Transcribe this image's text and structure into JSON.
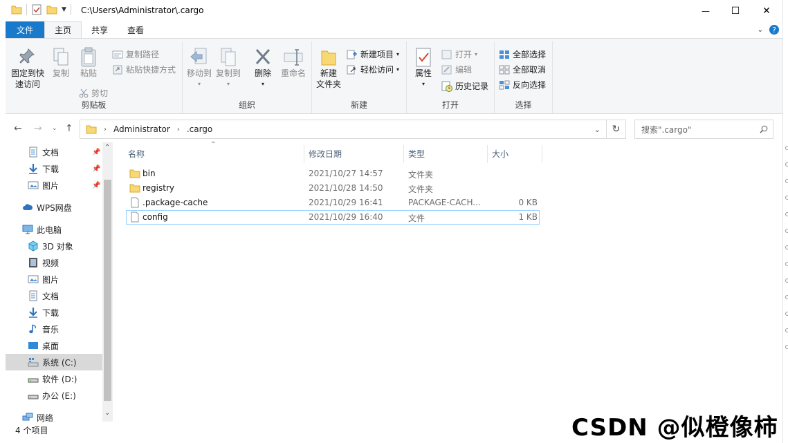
{
  "window": {
    "title": "C:\\Users\\Administrator\\.cargo",
    "minimize": "—",
    "maximize": "☐",
    "close": "✕"
  },
  "tabs": {
    "file": "文件",
    "home": "主页",
    "share": "共享",
    "view": "查看"
  },
  "ribbon": {
    "clipboard": {
      "label": "剪贴板",
      "pin": "固定到快速访问",
      "pin_line1": "固定到快",
      "pin_line2": "速访问",
      "copy": "复制",
      "paste": "粘贴",
      "copy_path": "复制路径",
      "paste_shortcut": "粘贴快捷方式",
      "cut": "剪切"
    },
    "organize": {
      "label": "组织",
      "move_to": "移动到",
      "copy_to": "复制到",
      "delete": "删除",
      "rename": "重命名"
    },
    "new": {
      "label": "新建",
      "new_folder_line1": "新建",
      "new_folder_line2": "文件夹",
      "new_item": "新建项目",
      "easy_access": "轻松访问"
    },
    "open": {
      "label": "打开",
      "properties": "属性",
      "open": "打开",
      "edit": "编辑",
      "history": "历史记录"
    },
    "select": {
      "label": "选择",
      "select_all": "全部选择",
      "select_none": "全部取消",
      "invert": "反向选择"
    }
  },
  "address": {
    "segments": [
      "Administrator",
      ".cargo"
    ],
    "search_placeholder": "搜索\".cargo\""
  },
  "nav": {
    "items": [
      {
        "label": "文档",
        "icon": "document-icon",
        "pinned": true
      },
      {
        "label": "下载",
        "icon": "download-icon",
        "pinned": true
      },
      {
        "label": "图片",
        "icon": "picture-icon",
        "pinned": true
      },
      {
        "label": "WPS网盘",
        "icon": "cloud-icon",
        "pinned": false
      },
      {
        "label": "此电脑",
        "icon": "computer-icon",
        "pinned": false
      },
      {
        "label": "3D 对象",
        "icon": "3d-objects-icon",
        "pinned": false
      },
      {
        "label": "视频",
        "icon": "video-icon",
        "pinned": false
      },
      {
        "label": "图片",
        "icon": "picture-icon",
        "pinned": false
      },
      {
        "label": "文档",
        "icon": "document-icon",
        "pinned": false
      },
      {
        "label": "下载",
        "icon": "download-icon",
        "pinned": false
      },
      {
        "label": "音乐",
        "icon": "music-icon",
        "pinned": false
      },
      {
        "label": "桌面",
        "icon": "desktop-icon",
        "pinned": false
      },
      {
        "label": "系统 (C:)",
        "icon": "drive-icon",
        "pinned": false
      },
      {
        "label": "软件 (D:)",
        "icon": "drive-icon",
        "pinned": false
      },
      {
        "label": "办公 (E:)",
        "icon": "drive-icon",
        "pinned": false
      },
      {
        "label": "网络",
        "icon": "network-icon",
        "pinned": false
      }
    ]
  },
  "columns": {
    "name": "名称",
    "modified": "修改日期",
    "type": "类型",
    "size": "大小"
  },
  "files": [
    {
      "name": "bin",
      "modified": "2021/10/27 14:57",
      "type": "文件夹",
      "size": "",
      "kind": "folder"
    },
    {
      "name": "registry",
      "modified": "2021/10/28 14:50",
      "type": "文件夹",
      "size": "",
      "kind": "folder"
    },
    {
      "name": ".package-cache",
      "modified": "2021/10/29 16:41",
      "type": "PACKAGE-CACH...",
      "size": "0 KB",
      "kind": "file"
    },
    {
      "name": "config",
      "modified": "2021/10/29 16:40",
      "type": "文件",
      "size": "1 KB",
      "kind": "file"
    }
  ],
  "status": {
    "count": "4 个项目"
  },
  "watermark": "CSDN @似橙像柿",
  "colors": {
    "accent": "#1979ca",
    "folder": "#f8d775",
    "selection": "#cce8ff"
  }
}
